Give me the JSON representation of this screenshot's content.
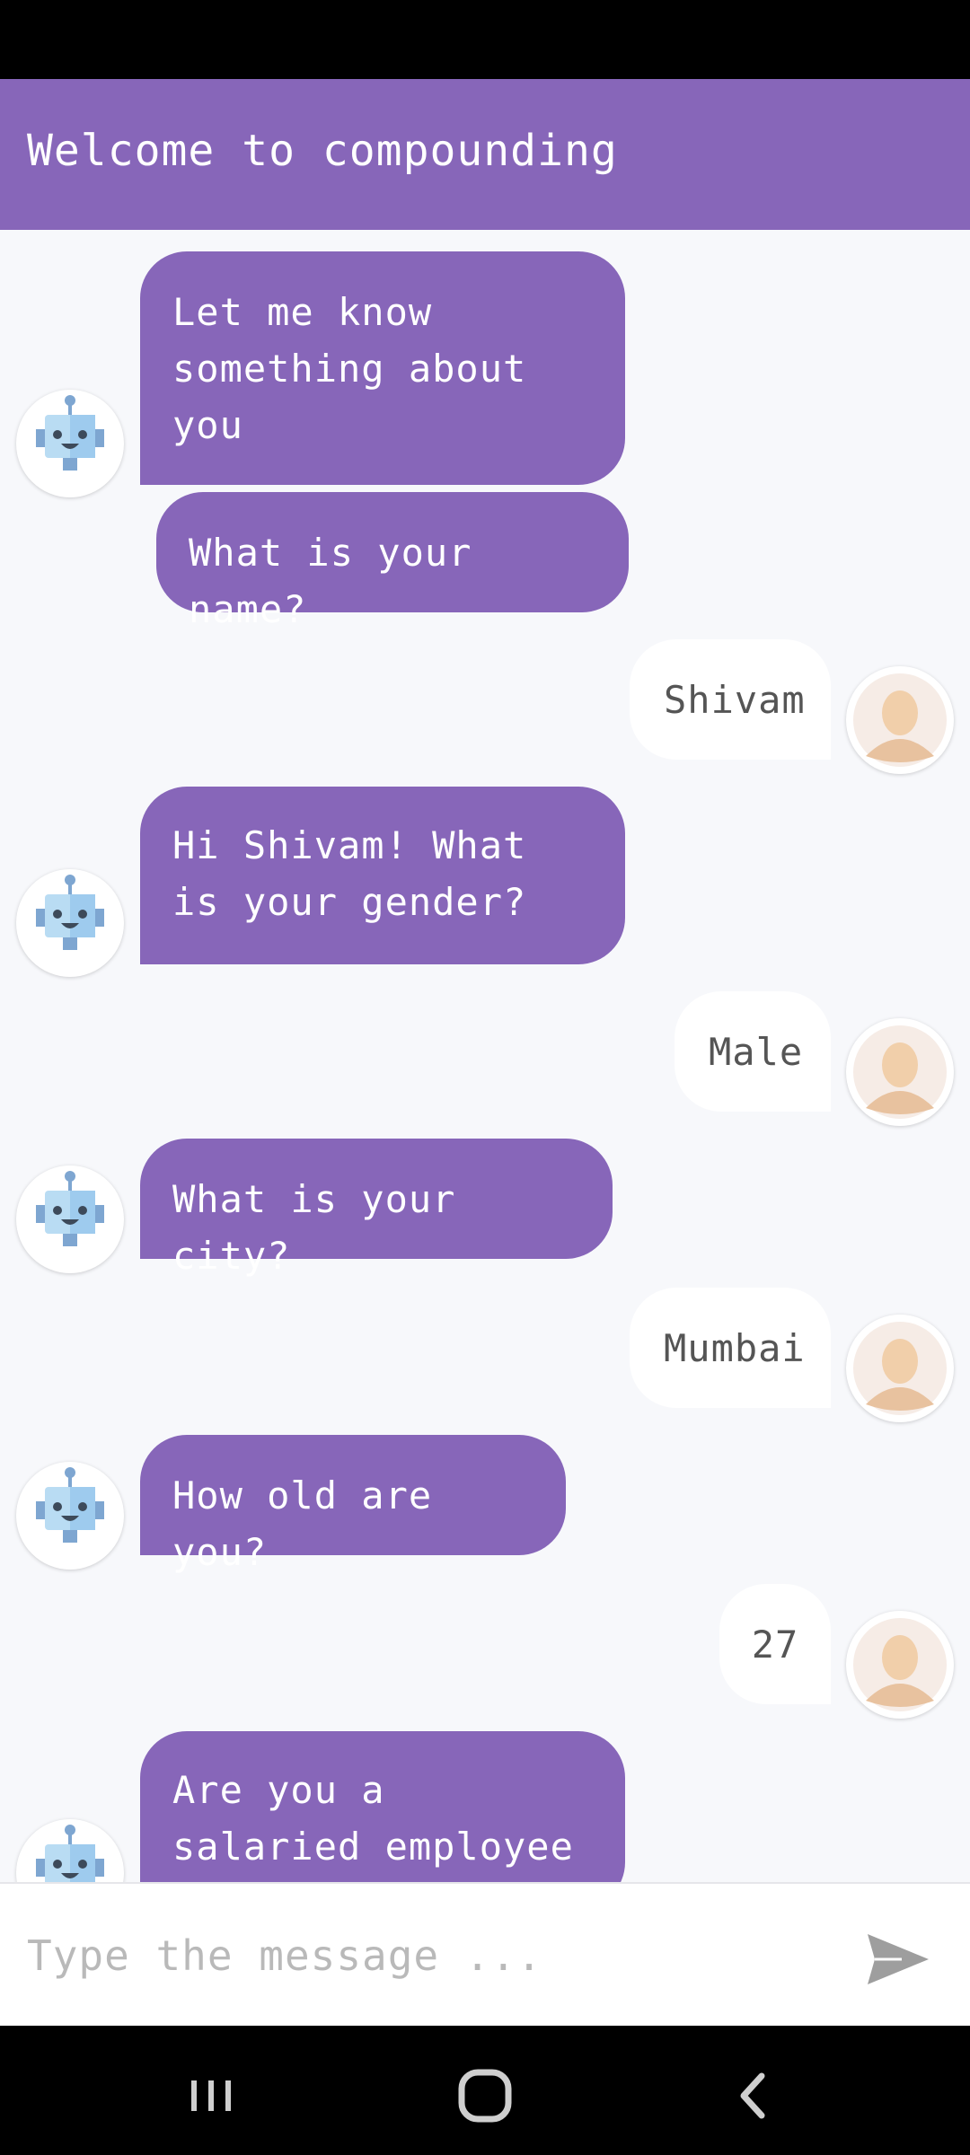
{
  "app": {
    "title": "Welcome to compounding"
  },
  "messages": [
    {
      "from": "bot",
      "text": "Let me know something about you"
    },
    {
      "from": "bot",
      "text": "What is your name?"
    },
    {
      "from": "user",
      "text": "Shivam"
    },
    {
      "from": "bot",
      "text": "Hi Shivam! What is your gender?"
    },
    {
      "from": "user",
      "text": "Male"
    },
    {
      "from": "bot",
      "text": "What is your city?"
    },
    {
      "from": "user",
      "text": "Mumbai"
    },
    {
      "from": "bot",
      "text": "How old are you?"
    },
    {
      "from": "user",
      "text": "27"
    },
    {
      "from": "bot",
      "text": "Are you a salaried employee ?"
    }
  ],
  "input": {
    "placeholder": "Type the message ..."
  },
  "icons": {
    "bot": "robot-avatar-icon",
    "user": "person-avatar-icon",
    "send": "send-icon",
    "nav_recents": "recents-icon",
    "nav_home": "home-icon",
    "nav_back": "back-icon"
  },
  "colors": {
    "accent": "#8766b9",
    "background": "#f7f8fb",
    "user_bubble": "#ffffff"
  }
}
